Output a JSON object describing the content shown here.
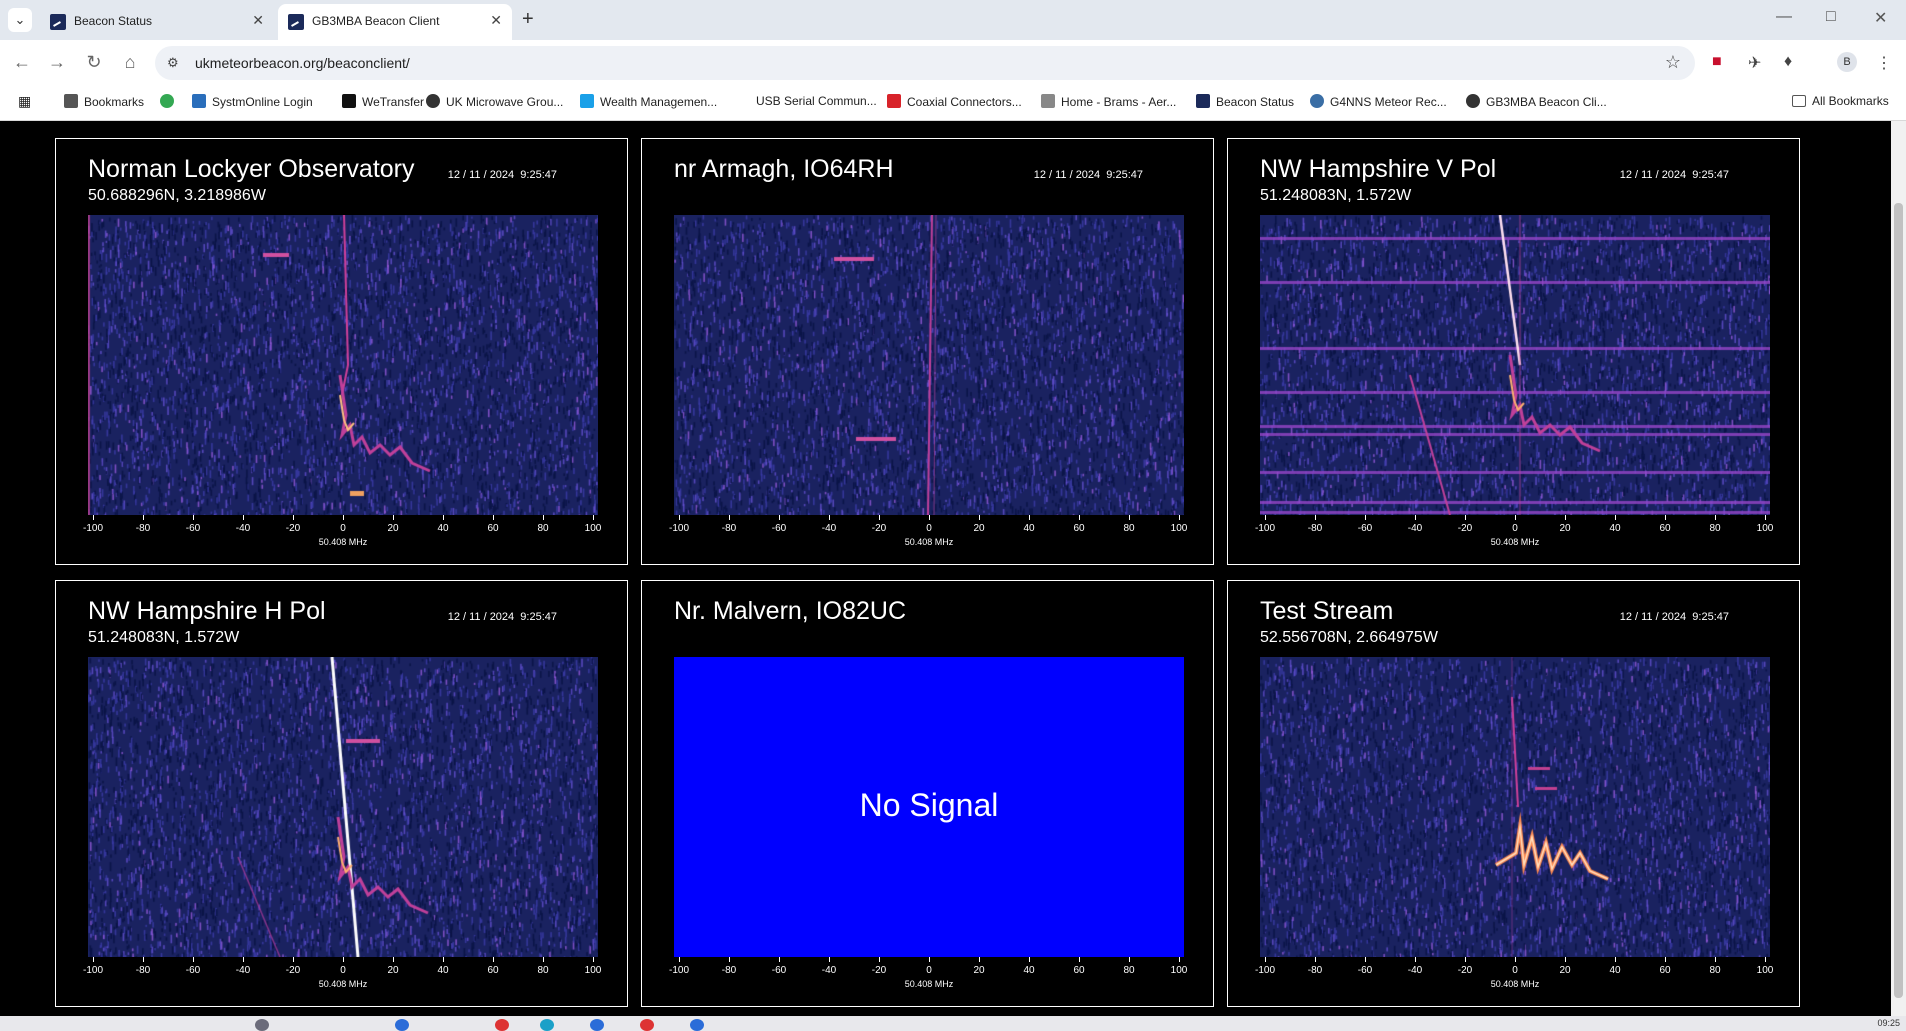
{
  "browser": {
    "tabs": [
      {
        "title": "Beacon Status",
        "active": false
      },
      {
        "title": "GB3MBA Beacon Client",
        "active": true
      }
    ],
    "url": "ukmeteorbeacon.org/beaconclient/",
    "profile_initial": "B",
    "bookmarks": [
      {
        "label": "Bookmarks",
        "icon": "star-icon"
      },
      {
        "label": "",
        "icon": "google-icon"
      },
      {
        "label": "SystmOnline Login",
        "icon": "systm-icon"
      },
      {
        "label": "WeTransfer",
        "icon": "wetransfer-icon"
      },
      {
        "label": "UK Microwave Grou...",
        "icon": "globe-icon"
      },
      {
        "label": "Wealth Managemen...",
        "icon": "hand-icon"
      },
      {
        "label": "USB Serial Commun...",
        "icon": ""
      },
      {
        "label": "Coaxial Connectors...",
        "icon": "rs-icon"
      },
      {
        "label": "Home - Brams - Aer...",
        "icon": "brams-icon"
      },
      {
        "label": "Beacon Status",
        "icon": "beacon-icon"
      },
      {
        "label": "G4NNS Meteor Rec...",
        "icon": "meteor-icon"
      },
      {
        "label": "GB3MBA Beacon Cli...",
        "icon": "globe-icon"
      }
    ],
    "all_bookmarks": "All Bookmarks"
  },
  "panels": [
    {
      "title": "Norman Lockyer Observatory",
      "date": "12 / 11 / 2024",
      "time": "9:25:47",
      "coords": "50.688296N, 3.218986W",
      "signal": true
    },
    {
      "title": "nr Armagh, IO64RH",
      "date": "12 / 11 / 2024",
      "time": "9:25:47",
      "coords": "",
      "signal": true
    },
    {
      "title": "NW Hampshire V Pol",
      "date": "12 / 11 / 2024",
      "time": "9:25:47",
      "coords": "51.248083N, 1.572W",
      "signal": true
    },
    {
      "title": "NW Hampshire H Pol",
      "date": "12 / 11 / 2024",
      "time": "9:25:47",
      "coords": "51.248083N, 1.572W",
      "signal": true
    },
    {
      "title": "Nr. Malvern, IO82UC",
      "date": "",
      "time": "",
      "coords": "",
      "signal": false,
      "no_signal_text": "No Signal"
    },
    {
      "title": "Test Stream",
      "date": "12 / 11 / 2024",
      "time": "9:25:47",
      "coords": "52.556708N, 2.664975W",
      "signal": true
    }
  ],
  "axis": {
    "ticks": [
      "-100",
      "-80",
      "-60",
      "-40",
      "-20",
      "0",
      "20",
      "40",
      "60",
      "80",
      "100"
    ],
    "label": "50.408 MHz"
  },
  "taskbar": {
    "clock": "09:25"
  },
  "colors": {
    "page_bg": "#000000",
    "no_signal_bg": "#0000ff",
    "waterfall_bg": "#1a2260"
  }
}
